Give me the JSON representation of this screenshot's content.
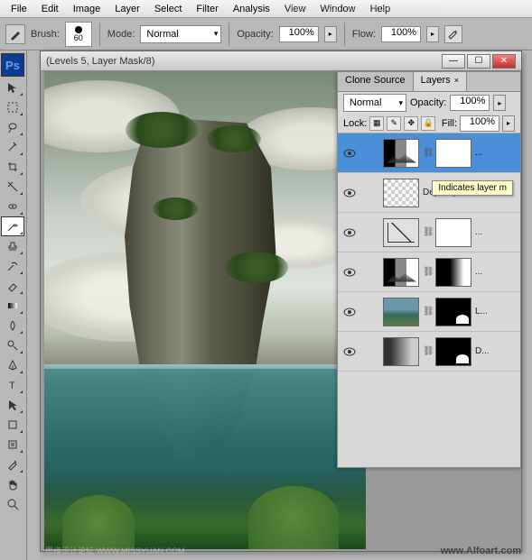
{
  "menu": [
    "File",
    "Edit",
    "Image",
    "Layer",
    "Select",
    "Filter",
    "Analysis",
    "View",
    "Window",
    "Help"
  ],
  "optbar": {
    "brush_label": "Brush:",
    "brush_size": "60",
    "mode_label": "Mode:",
    "mode_value": "Normal",
    "opacity_label": "Opacity:",
    "opacity_value": "100%",
    "flow_label": "Flow:",
    "flow_value": "100%"
  },
  "doc": {
    "title": "(Levels 5, Layer Mask/8)"
  },
  "panel": {
    "tabs": [
      "Clone Source",
      "Layers"
    ],
    "active_tab": 1,
    "blend_mode": "Normal",
    "opacity_label": "Opacity:",
    "opacity_value": "100%",
    "lock_label": "Lock:",
    "fill_label": "Fill:",
    "fill_value": "100%"
  },
  "layers": [
    {
      "name": "...",
      "sel": true,
      "thumb": "levels",
      "mask": "mask"
    },
    {
      "name": "Depositpho...",
      "sel": false,
      "thumb": "checker",
      "mask": null
    },
    {
      "name": "...",
      "sel": false,
      "thumb": "curves",
      "mask": "mask"
    },
    {
      "name": "...",
      "sel": false,
      "thumb": "levels",
      "mask": "mask-grad"
    },
    {
      "name": "L...",
      "sel": false,
      "thumb": "photo",
      "mask": "mask-black"
    },
    {
      "name": "D...",
      "sel": false,
      "thumb": "bw",
      "mask": "mask-black"
    }
  ],
  "tooltip": "Indicates layer m",
  "watermarks": {
    "top": "思缘设计论坛 WWW.MISSYUAN.COM",
    "bottom": "www.Alfoart.com",
    "bottom2": "思缘设计论坛 WWW.MISSYUAN.COM"
  }
}
